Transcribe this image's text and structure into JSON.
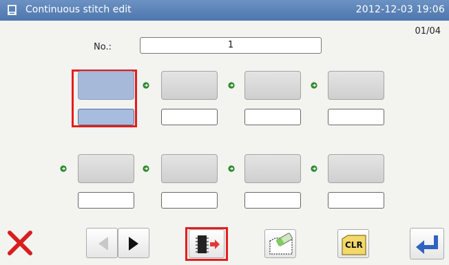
{
  "title_bar": {
    "title": "Continuous stitch edit",
    "datetime": "2012-12-03  19:06"
  },
  "page_counter": "01/04",
  "number_field": {
    "label": "No.:",
    "value": "1"
  },
  "pattern_rows": [
    {
      "slots": [
        {
          "value": "",
          "selected": true
        },
        {
          "value": "",
          "selected": false
        },
        {
          "value": "",
          "selected": false
        },
        {
          "value": "",
          "selected": false
        }
      ]
    },
    {
      "slots": [
        {
          "value": "",
          "selected": false
        },
        {
          "value": "",
          "selected": false
        },
        {
          "value": "",
          "selected": false
        },
        {
          "value": "",
          "selected": false
        }
      ]
    }
  ],
  "toolbar": {
    "cancel_icon": "close-x-icon",
    "prev_icon": "triangle-left-icon",
    "next_icon": "triangle-right-icon",
    "write_icon": "memory-write-icon",
    "erase_icon": "eraser-icon",
    "clear_label": "CLR",
    "enter_icon": "enter-return-icon"
  },
  "colors": {
    "title_bar": "#5b82b8",
    "selection_frame": "#e41c1c",
    "selected_slot": "#a6b9d8",
    "arrow_green": "#2d8a2d"
  }
}
